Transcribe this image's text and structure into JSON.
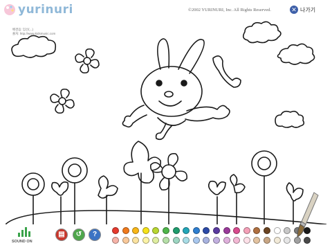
{
  "app": {
    "logo_text": "yurinuri",
    "copyright": "©2002 YURINURI, Inc. All Rights Reserved.",
    "exit_label": "나가기",
    "credit_line1": "배경음: 임선(...)",
    "credit_line2": "출처: http://www.kidsmusic.com"
  },
  "controls": {
    "sound_label": "SOUND ON",
    "print_icon": "print-icon",
    "undo_icon": "undo-icon",
    "help_glyph": "?"
  },
  "palette": {
    "row1": [
      "#e63a2e",
      "#f07a1c",
      "#f8b617",
      "#f5e21a",
      "#b8d630",
      "#4fb64a",
      "#1f9c6d",
      "#22a6b8",
      "#2e7fd1",
      "#2c4aa8",
      "#5a3aa0",
      "#9a3a9a",
      "#d84b8e",
      "#f4a0b8",
      "#b07040",
      "#6b4422",
      "#ffffff",
      "#c8c8c8",
      "#7a7a7a",
      "#1a1a1a"
    ],
    "row2": [
      "#f6b3a8",
      "#f9c99a",
      "#fbe3a0",
      "#fbf3a6",
      "#dfeea0",
      "#b6e0a8",
      "#9dd6c2",
      "#a8dde6",
      "#a9c8ef",
      "#a8b3e0",
      "#c2b0e0",
      "#dfb0dc",
      "#f3b8d4",
      "#fde0e8",
      "#e3c3a0",
      "#c8a684",
      "#f2ead8",
      "#e6e6e6",
      "#a0a0a0",
      "#4a4a4a"
    ]
  },
  "colors": {
    "logo": "#8fb8d8",
    "exit_button": "#3d5fa8",
    "line_art": "#1a1a1a"
  }
}
